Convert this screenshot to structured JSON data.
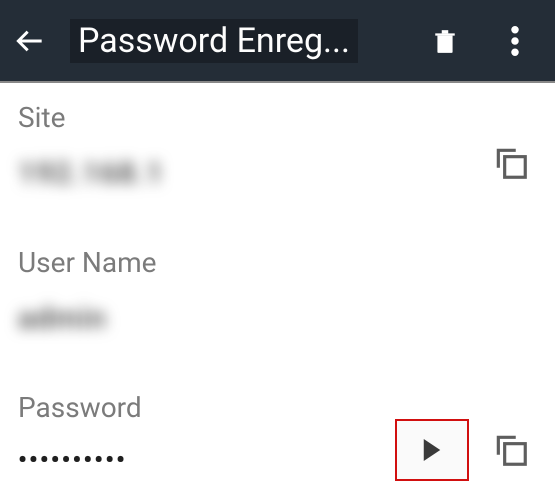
{
  "header": {
    "title": "Password Enreg..."
  },
  "site": {
    "label": "Site",
    "value": "192.168.1"
  },
  "username": {
    "label": "User Name",
    "value": "admin"
  },
  "password": {
    "label": "Password",
    "masked": "••••••••••"
  },
  "colors": {
    "header_bg": "#242d37",
    "highlight": "#d10f0f"
  }
}
